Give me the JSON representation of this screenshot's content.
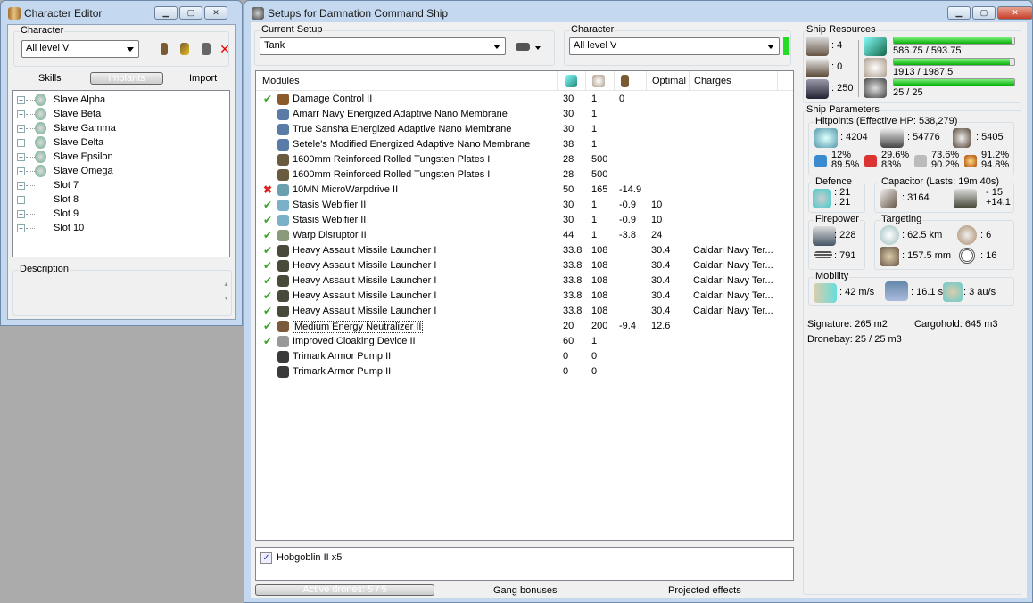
{
  "char_editor": {
    "title": "Character Editor",
    "character_label": "Character",
    "character_value": "All level V",
    "tabs": [
      "Skills",
      "Implants",
      "Import"
    ],
    "slots": [
      "Slave Alpha",
      "Slave Beta",
      "Slave Gamma",
      "Slave Delta",
      "Slave Epsilon",
      "Slave Omega",
      "Slot 7",
      "Slot 8",
      "Slot 9",
      "Slot 10"
    ],
    "description_label": "Description"
  },
  "setup": {
    "title": "Setups for Damnation Command Ship",
    "current_setup_label": "Current Setup",
    "current_setup_value": "Tank",
    "character_label": "Character",
    "character_value": "All level V",
    "status_color": "#22dd22",
    "columns": [
      "Modules",
      "cpu-icon",
      "powergrid-icon",
      "capacitor-icon",
      "Optimal",
      "Charges"
    ],
    "modules": [
      {
        "status": "ok",
        "name": "Damage Control II",
        "cpu": "30",
        "pg": "1",
        "cap": "0",
        "optimal": "",
        "charges": "",
        "color": "#8a5a2a"
      },
      {
        "status": "",
        "name": "Amarr Navy Energized Adaptive Nano Membrane",
        "cpu": "30",
        "pg": "1",
        "cap": "",
        "optimal": "",
        "charges": "",
        "color": "#5a7aa8"
      },
      {
        "status": "",
        "name": "True Sansha Energized Adaptive Nano Membrane",
        "cpu": "30",
        "pg": "1",
        "cap": "",
        "optimal": "",
        "charges": "",
        "color": "#5a7aa8"
      },
      {
        "status": "",
        "name": "Setele's Modified Energized Adaptive Nano Membrane",
        "cpu": "38",
        "pg": "1",
        "cap": "",
        "optimal": "",
        "charges": "",
        "color": "#5a7aa8"
      },
      {
        "status": "",
        "name": "1600mm Reinforced Rolled Tungsten Plates I",
        "cpu": "28",
        "pg": "500",
        "cap": "",
        "optimal": "",
        "charges": "",
        "color": "#6a5a40"
      },
      {
        "status": "",
        "name": "1600mm Reinforced Rolled Tungsten Plates I",
        "cpu": "28",
        "pg": "500",
        "cap": "",
        "optimal": "",
        "charges": "",
        "color": "#6a5a40"
      },
      {
        "status": "err",
        "name": "10MN MicroWarpdrive II",
        "cpu": "50",
        "pg": "165",
        "cap": "-14.9",
        "optimal": "",
        "charges": "",
        "color": "#6aa0b0"
      },
      {
        "status": "ok",
        "name": "Stasis Webifier II",
        "cpu": "30",
        "pg": "1",
        "cap": "-0.9",
        "optimal": "10",
        "charges": "",
        "color": "#7ab0c8"
      },
      {
        "status": "ok",
        "name": "Stasis Webifier II",
        "cpu": "30",
        "pg": "1",
        "cap": "-0.9",
        "optimal": "10",
        "charges": "",
        "color": "#7ab0c8"
      },
      {
        "status": "ok",
        "name": "Warp Disruptor II",
        "cpu": "44",
        "pg": "1",
        "cap": "-3.8",
        "optimal": "24",
        "charges": "",
        "color": "#8a9a7a"
      },
      {
        "status": "ok",
        "name": "Heavy Assault Missile Launcher I",
        "cpu": "33.8",
        "pg": "108",
        "cap": "",
        "optimal": "30.4",
        "charges": "Caldari Navy Ter...",
        "color": "#4a4a3a"
      },
      {
        "status": "ok",
        "name": "Heavy Assault Missile Launcher I",
        "cpu": "33.8",
        "pg": "108",
        "cap": "",
        "optimal": "30.4",
        "charges": "Caldari Navy Ter...",
        "color": "#4a4a3a"
      },
      {
        "status": "ok",
        "name": "Heavy Assault Missile Launcher I",
        "cpu": "33.8",
        "pg": "108",
        "cap": "",
        "optimal": "30.4",
        "charges": "Caldari Navy Ter...",
        "color": "#4a4a3a"
      },
      {
        "status": "ok",
        "name": "Heavy Assault Missile Launcher I",
        "cpu": "33.8",
        "pg": "108",
        "cap": "",
        "optimal": "30.4",
        "charges": "Caldari Navy Ter...",
        "color": "#4a4a3a"
      },
      {
        "status": "ok",
        "name": "Heavy Assault Missile Launcher I",
        "cpu": "33.8",
        "pg": "108",
        "cap": "",
        "optimal": "30.4",
        "charges": "Caldari Navy Ter...",
        "color": "#4a4a3a"
      },
      {
        "status": "ok",
        "name": "Medium Energy Neutralizer II",
        "cpu": "20",
        "pg": "200",
        "cap": "-9.4",
        "optimal": "12.6",
        "charges": "",
        "color": "#7a5a3a"
      },
      {
        "status": "ok",
        "name": "Improved Cloaking Device II",
        "cpu": "60",
        "pg": "1",
        "cap": "",
        "optimal": "",
        "charges": "",
        "color": "#999"
      },
      {
        "status": "",
        "name": "Trimark Armor Pump II",
        "cpu": "0",
        "pg": "0",
        "cap": "",
        "optimal": "",
        "charges": "",
        "color": "#3a3a3a"
      },
      {
        "status": "",
        "name": "Trimark Armor Pump II",
        "cpu": "0",
        "pg": "0",
        "cap": "",
        "optimal": "",
        "charges": "",
        "color": "#3a3a3a"
      }
    ],
    "drones": [
      {
        "name": "Hobgoblin II x5",
        "checked": true
      }
    ],
    "bottom_tabs": [
      "Active drones: 5 / 5",
      "Gang bonuses",
      "Projected effects"
    ]
  },
  "resources": {
    "label": "Ship Resources",
    "turrets": ": 4",
    "launchers": ": 0",
    "calibration": ": 250",
    "cpu": {
      "text": "586.75 / 593.75",
      "fraction": 0.988
    },
    "powergrid": {
      "text": "1913 / 1987.5",
      "fraction": 0.962
    },
    "drone_bw": {
      "text": "25 / 25",
      "fraction": 1.0
    }
  },
  "params": {
    "label": "Ship Parameters",
    "hp_label": "Hitpoints (Effective HP: 538,279)",
    "shield": ": 4204",
    "armor": ": 54776",
    "structure": ": 5405",
    "resists": [
      [
        "12%",
        "89.5%"
      ],
      [
        "29.6%",
        "83%"
      ],
      [
        "73.6%",
        "90.2%"
      ],
      [
        "91.2%",
        "94.8%"
      ]
    ],
    "defence_label": "Defence",
    "defence": [
      ": 21",
      ": 21"
    ],
    "cap_label": "Capacitor (Lasts: 19m 40s)",
    "cap": ": 3164",
    "cap_delta": [
      "- 15",
      "+14.1"
    ],
    "firepower_label": "Firepower",
    "dps": ": 228",
    "volley": ": 791",
    "targeting_label": "Targeting",
    "range": ": 62.5 km",
    "max_targets": ": 6",
    "scan_res": ": 157.5 mm",
    "sensor": ": 16",
    "mobility_label": "Mobility",
    "speed": ": 42 m/s",
    "align": ": 16.1 s",
    "warp": ": 3 au/s",
    "signature": "Signature: 265 m2",
    "cargo": "Cargohold: 645 m3",
    "dronebay": "Dronebay: 25 / 25 m3"
  }
}
